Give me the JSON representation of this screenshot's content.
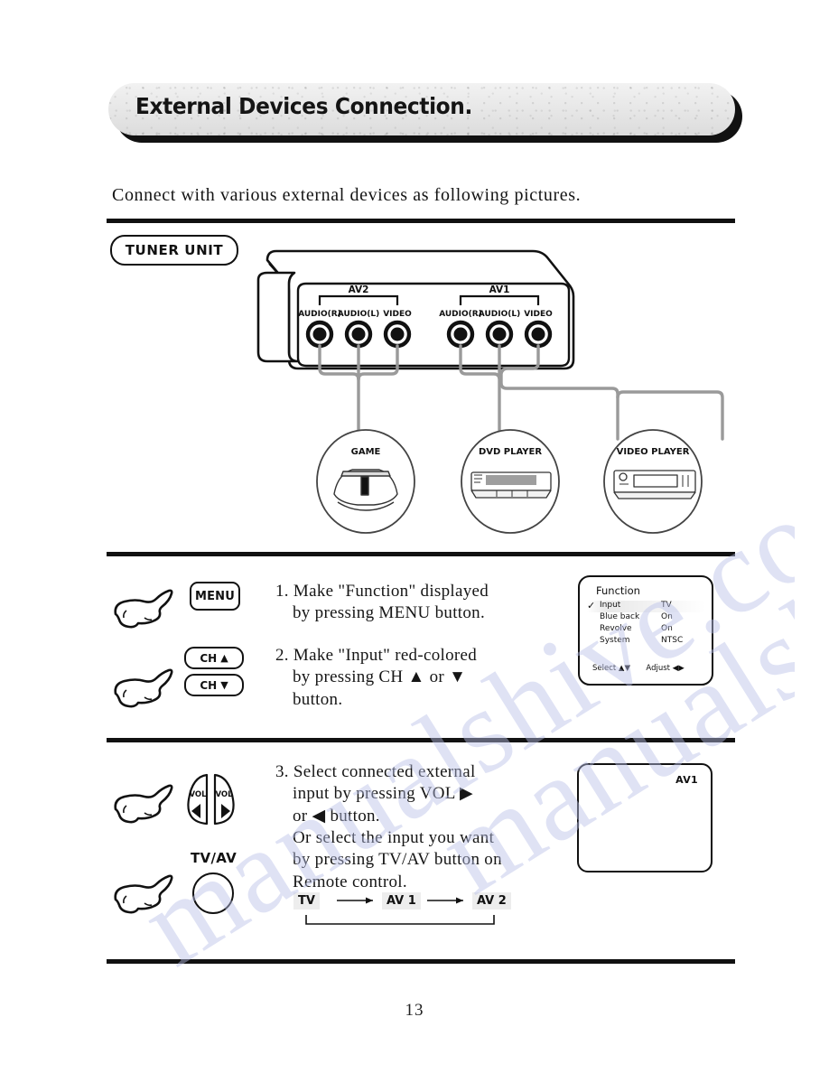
{
  "header": {
    "title": "External Devices Connection."
  },
  "intro": {
    "text": "Connect with various external devices as following pictures."
  },
  "watermark": {
    "line1": "manualshive.com",
    "line2": "manualshive.com"
  },
  "diagram": {
    "unit_label": "TUNER UNIT",
    "groups": [
      {
        "name": "AV2",
        "jacks": [
          "AUDIO(R)",
          "AUDIO(L)",
          "VIDEO"
        ]
      },
      {
        "name": "AV1",
        "jacks": [
          "AUDIO(R)",
          "AUDIO(L)",
          "VIDEO"
        ]
      }
    ],
    "devices": [
      {
        "label": "GAME"
      },
      {
        "label": "DVD PLAYER"
      },
      {
        "label": "VIDEO PLAYER"
      }
    ]
  },
  "steps": [
    {
      "number": "1.",
      "line1": "Make \"Function\" displayed",
      "line2": "by pressing MENU button.",
      "button": "MENU"
    },
    {
      "number": "2.",
      "line1": "Make \"Input\" red-colored",
      "line2": "by pressing CH ▲ or ▼",
      "line3": "button.",
      "button_up": "CH",
      "button_up_glyph": "▲",
      "button_down": "CH",
      "button_down_glyph": "▼"
    },
    {
      "number": "3.",
      "line1": "Select connected external",
      "line2": "input by pressing VOL ▶",
      "line3": "or ◀ button.",
      "line4": "Or select the input you want",
      "line5": "by pressing TV/AV button on",
      "line6": "Remote control.",
      "vol_left_label": "VOL",
      "vol_left_glyph": "◀",
      "vol_right_label": "VOL",
      "vol_right_glyph": "▶",
      "tvav_label": "TV/AV"
    }
  ],
  "osd": {
    "title": "Function",
    "rows": [
      {
        "check": "✓",
        "label": "Input",
        "value": "TV",
        "selected": true
      },
      {
        "check": "",
        "label": "Blue back",
        "value": "On",
        "selected": false
      },
      {
        "check": "",
        "label": "Revolve",
        "value": "On",
        "selected": false
      },
      {
        "check": "",
        "label": "System",
        "value": "NTSC",
        "selected": false
      }
    ],
    "footer_select": "Select ▲▼",
    "footer_adjust": "Adjust ◀▶"
  },
  "av_screen": {
    "tag": "AV1"
  },
  "cycle": {
    "items": [
      "TV",
      "AV 1",
      "AV 2"
    ]
  },
  "footer": {
    "page_number": "13"
  }
}
